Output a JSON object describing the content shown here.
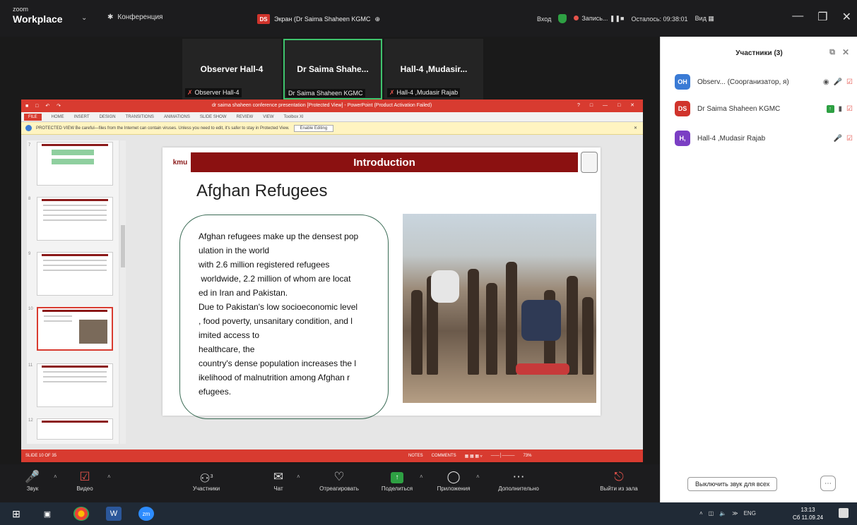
{
  "topbar": {
    "brand_small": "zoom",
    "brand": "Workplace",
    "conference_label": "Конференция",
    "share_badge": "DS",
    "share_label": "Экран (Dr Saima Shaheen KGMC",
    "login_label": "Вход",
    "recording_label": "Запись...",
    "time_left": "Осталось: 09:38:01",
    "view_label": "Вид"
  },
  "tiles": [
    {
      "name": "Observer  Hall-4",
      "label": "Observer  Hall-4"
    },
    {
      "name": "Dr Saima Shahe...",
      "label": "Dr Saima Shaheen KGMC"
    },
    {
      "name": "Hall-4 ,Mudasir...",
      "label": "Hall-4 ,Mudasir Rajab"
    }
  ],
  "ppt": {
    "title": "dr saima shaheen conference presentation [Protected View] - PowerPoint (Product Activation Failed)",
    "ribbon": [
      "FILE",
      "HOME",
      "INSERT",
      "DESIGN",
      "TRANSITIONS",
      "ANIMATIONS",
      "SLIDE SHOW",
      "REVIEW",
      "VIEW",
      "Toolbox XI"
    ],
    "protected_text": "PROTECTED VIEW  Be careful—files from the Internet can contain viruses. Unless you need to edit, it's safer to stay in Protected View.",
    "enable_editing": "Enable Editing",
    "thumb_numbers": [
      "7",
      "8",
      "9",
      "10",
      "11",
      "12"
    ],
    "status_left": "SLIDE 10 OF 35",
    "status_right": [
      "NOTES",
      "COMMENTS",
      "73%"
    ]
  },
  "slide": {
    "logo": "kmu",
    "header": "Introduction",
    "title": "Afghan Refugees",
    "body": [
      "Afghan refugees make up the densest pop",
      "ulation in the world",
      "with 2.6 million registered refugees",
      " worldwide, 2.2 million of whom are locat",
      "ed in Iran and Pakistan.",
      "Due to Pakistan's low socioeconomic level",
      ", food poverty, unsanitary condition, and l",
      "imited access to",
      "healthcare, the",
      "country's dense population increases the l",
      "ikelihood of malnutrition among Afghan r",
      "efugees."
    ]
  },
  "toolbar": {
    "audio": "Звук",
    "video": "Видео",
    "participants": "Участники",
    "participants_count": "3",
    "chat": "Чат",
    "react": "Отреагировать",
    "share": "Поделиться",
    "apps": "Приложения",
    "more": "Дополнительно",
    "leave": "Выйти из зала"
  },
  "panel": {
    "title": "Участники (3)",
    "participants": [
      {
        "initials": "OH",
        "name": "Observ... (Соорганизатор, я)",
        "color": "#3a7bd5"
      },
      {
        "initials": "DS",
        "name": "Dr Saima Shaheen KGMC",
        "color": "#d0342c"
      },
      {
        "initials": "H,",
        "name": "Hall-4 ,Mudasir Rajab",
        "color": "#7b3fc4"
      }
    ],
    "mute_all": "Выключить звук для всех"
  },
  "taskbar": {
    "lang": "ENG",
    "time": "13:13",
    "date": "Сб 11.09.24"
  }
}
